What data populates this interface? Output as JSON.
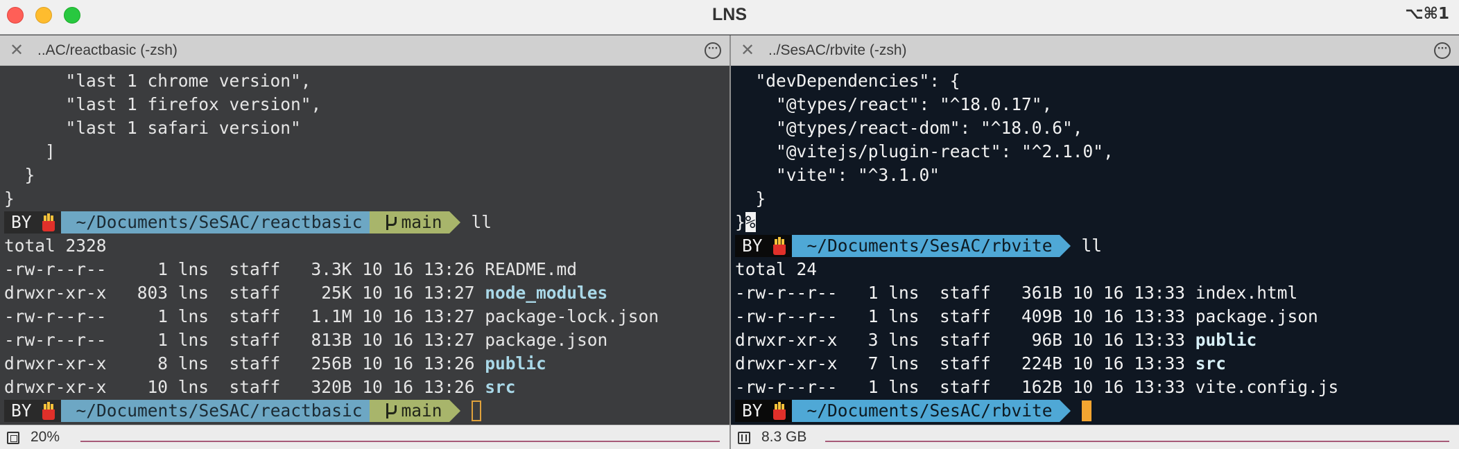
{
  "window": {
    "title": "LNS",
    "shortcut": "⌥⌘1"
  },
  "colors": {
    "left_bg": "#3b3c3e",
    "right_bg": "#0f1722",
    "path_segment": "#6da7c4",
    "git_segment": "#a8b56b",
    "cursor": "#f3a531"
  },
  "left_pane": {
    "tab_title": "..AC/reactbasic (-zsh)",
    "lines_top": [
      "      \"last 1 chrome version\",",
      "      \"last 1 firefox version\",",
      "      \"last 1 safari version\"",
      "    ]",
      "  }",
      "}"
    ],
    "prompt": {
      "user": "BY",
      "path": "~/Documents/SeSAC/reactbasic",
      "branch": "main",
      "command": "ll"
    },
    "total": "total 2328",
    "listing": [
      {
        "perm": "-rw-r--r--",
        "links": "   1",
        "user": "lns",
        "group": "staff",
        "size": "3.3K",
        "date": "10 16 13:26",
        "name": "README.md",
        "is_dir": false
      },
      {
        "perm": "drwxr-xr-x",
        "links": " 803",
        "user": "lns",
        "group": "staff",
        "size": " 25K",
        "date": "10 16 13:27",
        "name": "node_modules",
        "is_dir": true
      },
      {
        "perm": "-rw-r--r--",
        "links": "   1",
        "user": "lns",
        "group": "staff",
        "size": "1.1M",
        "date": "10 16 13:27",
        "name": "package-lock.json",
        "is_dir": false
      },
      {
        "perm": "-rw-r--r--",
        "links": "   1",
        "user": "lns",
        "group": "staff",
        "size": "813B",
        "date": "10 16 13:27",
        "name": "package.json",
        "is_dir": false
      },
      {
        "perm": "drwxr-xr-x",
        "links": "   8",
        "user": "lns",
        "group": "staff",
        "size": "256B",
        "date": "10 16 13:26",
        "name": "public",
        "is_dir": true
      },
      {
        "perm": "drwxr-xr-x",
        "links": "  10",
        "user": "lns",
        "group": "staff",
        "size": "320B",
        "date": "10 16 13:26",
        "name": "src",
        "is_dir": true
      }
    ],
    "status_text": "20%"
  },
  "right_pane": {
    "tab_title": "../SesAC/rbvite (-zsh)",
    "lines_top": [
      "  \"devDependencies\": {",
      "    \"@types/react\": \"^18.0.17\",",
      "    \"@types/react-dom\": \"^18.0.6\",",
      "    \"@vitejs/plugin-react\": \"^2.1.0\",",
      "    \"vite\": \"^3.1.0\"",
      "  }"
    ],
    "last_brace": "}",
    "eol_mark": "%",
    "prompt": {
      "user": "BY",
      "path": "~/Documents/SesAC/rbvite",
      "command": "ll"
    },
    "total": "total 24",
    "listing": [
      {
        "perm": "-rw-r--r--",
        "links": " 1",
        "user": "lns",
        "group": "staff",
        "size": "361B",
        "date": "10 16 13:33",
        "name": "index.html",
        "is_dir": false
      },
      {
        "perm": "-rw-r--r--",
        "links": " 1",
        "user": "lns",
        "group": "staff",
        "size": "409B",
        "date": "10 16 13:33",
        "name": "package.json",
        "is_dir": false
      },
      {
        "perm": "drwxr-xr-x",
        "links": " 3",
        "user": "lns",
        "group": "staff",
        "size": " 96B",
        "date": "10 16 13:33",
        "name": "public",
        "is_dir": true
      },
      {
        "perm": "drwxr-xr-x",
        "links": " 7",
        "user": "lns",
        "group": "staff",
        "size": "224B",
        "date": "10 16 13:33",
        "name": "src",
        "is_dir": true
      },
      {
        "perm": "-rw-r--r--",
        "links": " 1",
        "user": "lns",
        "group": "staff",
        "size": "162B",
        "date": "10 16 13:33",
        "name": "vite.config.js",
        "is_dir": false
      }
    ],
    "status_text": "8.3 GB"
  },
  "icons": {
    "tab_close": "close-icon",
    "tab_menu": "ellipsis-circle-icon",
    "emoji": "french-fries-icon",
    "branch": "git-branch-icon",
    "cpu": "cpu-icon",
    "memory": "memory-icon"
  }
}
